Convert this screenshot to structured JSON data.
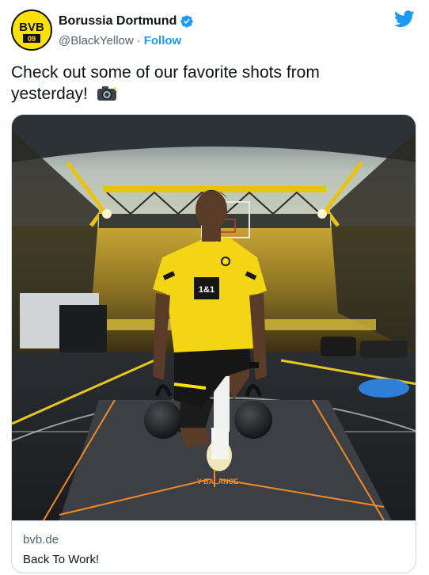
{
  "tweet": {
    "author": {
      "display_name": "Borussia Dortmund",
      "handle": "@BlackYellow",
      "separator": "·",
      "follow_label": "Follow",
      "verified": true,
      "avatar_text": "BVB",
      "avatar_subtext": "09"
    },
    "text": "Check out some of our favorite shots from yesterday!",
    "emoji": "camera-flash-emoji",
    "media": {
      "description_icon": "photo",
      "jersey_sponsor": "1&1",
      "floor_label": "Y BALANCE"
    },
    "link_card": {
      "domain": "bvb.de",
      "title": "Back To Work!"
    }
  },
  "colors": {
    "brand_blue": "#1d9bf0",
    "bvb_yellow": "#fde100",
    "text_primary": "#0f1419",
    "text_secondary": "#536471",
    "border": "#cfd9de"
  }
}
